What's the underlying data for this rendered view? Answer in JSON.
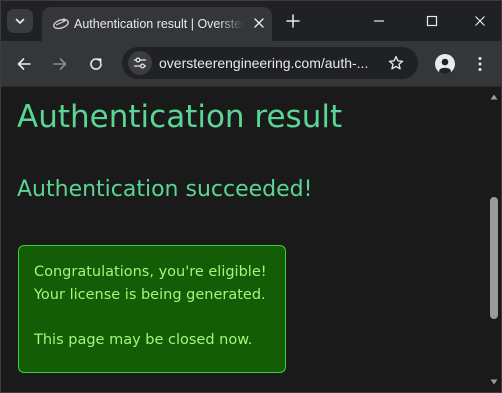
{
  "browser": {
    "tab": {
      "title": "Authentication result | Oversteer Engineering"
    },
    "omnibox": {
      "url": "oversteerengineering.com/auth-..."
    }
  },
  "page": {
    "heading": "Authentication result",
    "status": "Authentication succeeded!",
    "notice": {
      "line1": "Congratulations, you're eligible!",
      "line2": "Your license is being generated.",
      "line3": "This page may be closed now."
    }
  },
  "colors": {
    "heading_text": "#5ad694",
    "notice_background": "#145c05",
    "notice_border": "#36d13a",
    "notice_text": "#a2f77c"
  },
  "icons": {
    "tab_search": "chevron-down-icon",
    "favicon": "oversteer-logo-icon",
    "tab_close": "close-icon",
    "new_tab": "plus-icon",
    "minimize": "minimize-icon",
    "maximize": "maximize-icon",
    "window_close": "close-icon",
    "back": "arrow-left-icon",
    "forward": "arrow-right-icon",
    "reload": "reload-icon",
    "site_info": "tune-icon",
    "bookmark": "star-icon",
    "profile": "person-icon",
    "menu": "kebab-menu-icon"
  }
}
